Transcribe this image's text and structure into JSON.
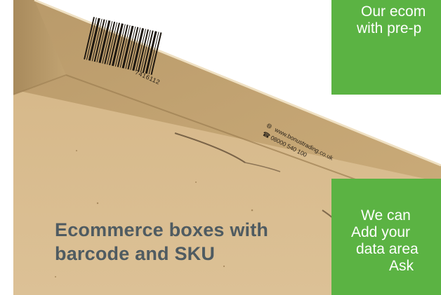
{
  "headline": {
    "line1": "Ecommerce boxes with",
    "line2": "barcode and SKU"
  },
  "barcode": {
    "number": "7416112"
  },
  "contact": {
    "website": "www.bonustrading.co.uk",
    "phone": "08000 540 100",
    "website_icon": "globe-icon",
    "phone_icon": "phone-icon"
  },
  "green_top": {
    "line1": "Our ecom",
    "line2": "with pre-p"
  },
  "green_bottom": {
    "line1": "We can",
    "line2": "Add your",
    "line3": "data area",
    "line4": "Ask"
  },
  "colors": {
    "green_panel": "#5bb343",
    "headline_text": "#4f5b61",
    "cardboard": "#d7b98a"
  }
}
